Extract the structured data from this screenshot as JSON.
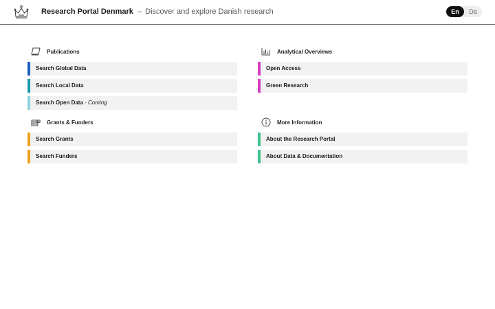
{
  "header": {
    "title": "Research Portal Denmark",
    "separator": "–",
    "tagline": "Discover and explore Danish research",
    "logo_icon": "crown-icon"
  },
  "language": {
    "options": [
      "En",
      "Da"
    ],
    "selected": "En"
  },
  "sections": {
    "publications": {
      "title": "Publications",
      "icon": "book-icon",
      "items": [
        {
          "label": "Search Global Data",
          "color": "#1f5fbf"
        },
        {
          "label": "Search Local Data",
          "color": "#1a9bb0"
        },
        {
          "label": "Search Open Data",
          "suffix": " - Coming",
          "color": "#8fd3df"
        }
      ]
    },
    "grants": {
      "title": "Grants & Funders",
      "icon": "money-stack-icon",
      "items": [
        {
          "label": "Search Grants",
          "color": "#f0a11c"
        },
        {
          "label": "Search Funders",
          "color": "#f0a11c"
        }
      ]
    },
    "analytical": {
      "title": "Analytical Overviews",
      "icon": "bar-chart-icon",
      "items": [
        {
          "label": "Open Access",
          "color": "#d63cc2"
        },
        {
          "label": "Green Research",
          "color": "#d63cc2"
        }
      ]
    },
    "info": {
      "title": "More Information",
      "icon": "info-icon",
      "items": [
        {
          "label": "About the Research Portal",
          "color": "#3fc48e"
        },
        {
          "label": "About Data & Documentation",
          "color": "#3fc48e"
        }
      ]
    }
  }
}
